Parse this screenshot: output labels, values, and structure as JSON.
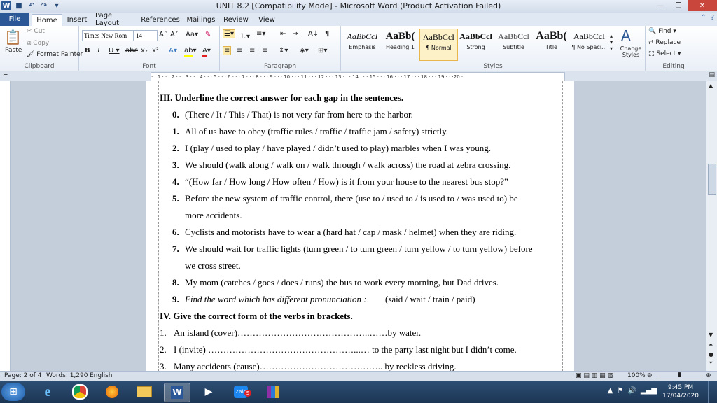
{
  "window": {
    "title": "UNIT 8.2 [Compatibility Mode] - Microsoft Word (Product Activation Failed)"
  },
  "tabs": [
    "File",
    "Home",
    "Insert",
    "Page Layout",
    "References",
    "Mailings",
    "Review",
    "View"
  ],
  "clipboard": {
    "paste": "Paste",
    "cut": "Cut",
    "copy": "Copy",
    "format_painter": "Format Painter",
    "label": "Clipboard"
  },
  "font": {
    "name": "Times New Rom",
    "size": "14",
    "label": "Font"
  },
  "paragraph": {
    "label": "Paragraph"
  },
  "styles": {
    "label": "Styles",
    "items": [
      {
        "preview": "AaBbCcI",
        "name": "Emphasis"
      },
      {
        "preview": "AaBb(",
        "name": "Heading 1"
      },
      {
        "preview": "AaBbCcI",
        "name": "¶ Normal"
      },
      {
        "preview": "AaBbCcl",
        "name": "Strong"
      },
      {
        "preview": "AaBbCcl",
        "name": "Subtitle"
      },
      {
        "preview": "AaBb(",
        "name": "Title"
      },
      {
        "preview": "AaBbCcI",
        "name": "¶ No Spaci..."
      }
    ],
    "change_styles": "Change Styles"
  },
  "editing": {
    "find": "Find",
    "replace": "Replace",
    "select": "Select",
    "label": "Editing"
  },
  "document": {
    "section3_title": "III. Underline the correct answer for each gap in the sentences.",
    "items": [
      {
        "n": "0.",
        "text": "(There / It / This / That) is not very far from here to the harbor."
      },
      {
        "n": "1.",
        "text": "All of us have to obey (traffic rules / traffic / traffic jam / safety) strictly."
      },
      {
        "n": "2.",
        "text": "I (play / used to play / have played / didn’t used to play) marbles when I was young."
      },
      {
        "n": "3.",
        "text": "We should (walk along / walk on / walk through / walk across) the road at zebra crossing."
      },
      {
        "n": "4.",
        "text": "“(How far / How long / How often / How) is it from your house to the nearest bus stop?”"
      },
      {
        "n": "5.",
        "text": "Before the new system of traffic control, there (use to / used to / is used to / was used to) be"
      },
      {
        "n": "",
        "text": "more accidents."
      },
      {
        "n": "6.",
        "text": "Cyclists and motorists have to wear a (hard hat / cap / mask / helmet) when they are riding."
      },
      {
        "n": "7.",
        "text": "We should wait for traffic lights (turn green / to turn green / turn yellow / to turn yellow) before"
      },
      {
        "n": "",
        "text": "we cross street."
      },
      {
        "n": "8.",
        "text": "My mom (catches / goes / does / runs) the bus to work every morning, but Dad drives."
      }
    ],
    "item9": {
      "n": "9.",
      "text": "Find the word which has different pronunciation :",
      "options": "(said / wait / train / paid)"
    },
    "section4_title": "IV. Give the correct form of the verbs in brackets.",
    "verbs": [
      {
        "n": "1.",
        "text": "An island (cover)……………………………………..……by water."
      },
      {
        "n": "2.",
        "text": "I (invite) …………………………………………...… to the party last night but I didn’t come."
      },
      {
        "n": "3.",
        "text": "Many accidents (cause)………………………………….. by reckless driving."
      }
    ]
  },
  "status": {
    "page": "Page: 2 of 4",
    "words": "Words: 1,290",
    "lang": "English",
    "zoom": "100%"
  },
  "clock": {
    "time": "9:45 PM",
    "date": "17/04/2020"
  },
  "taskbar_badge": "5"
}
